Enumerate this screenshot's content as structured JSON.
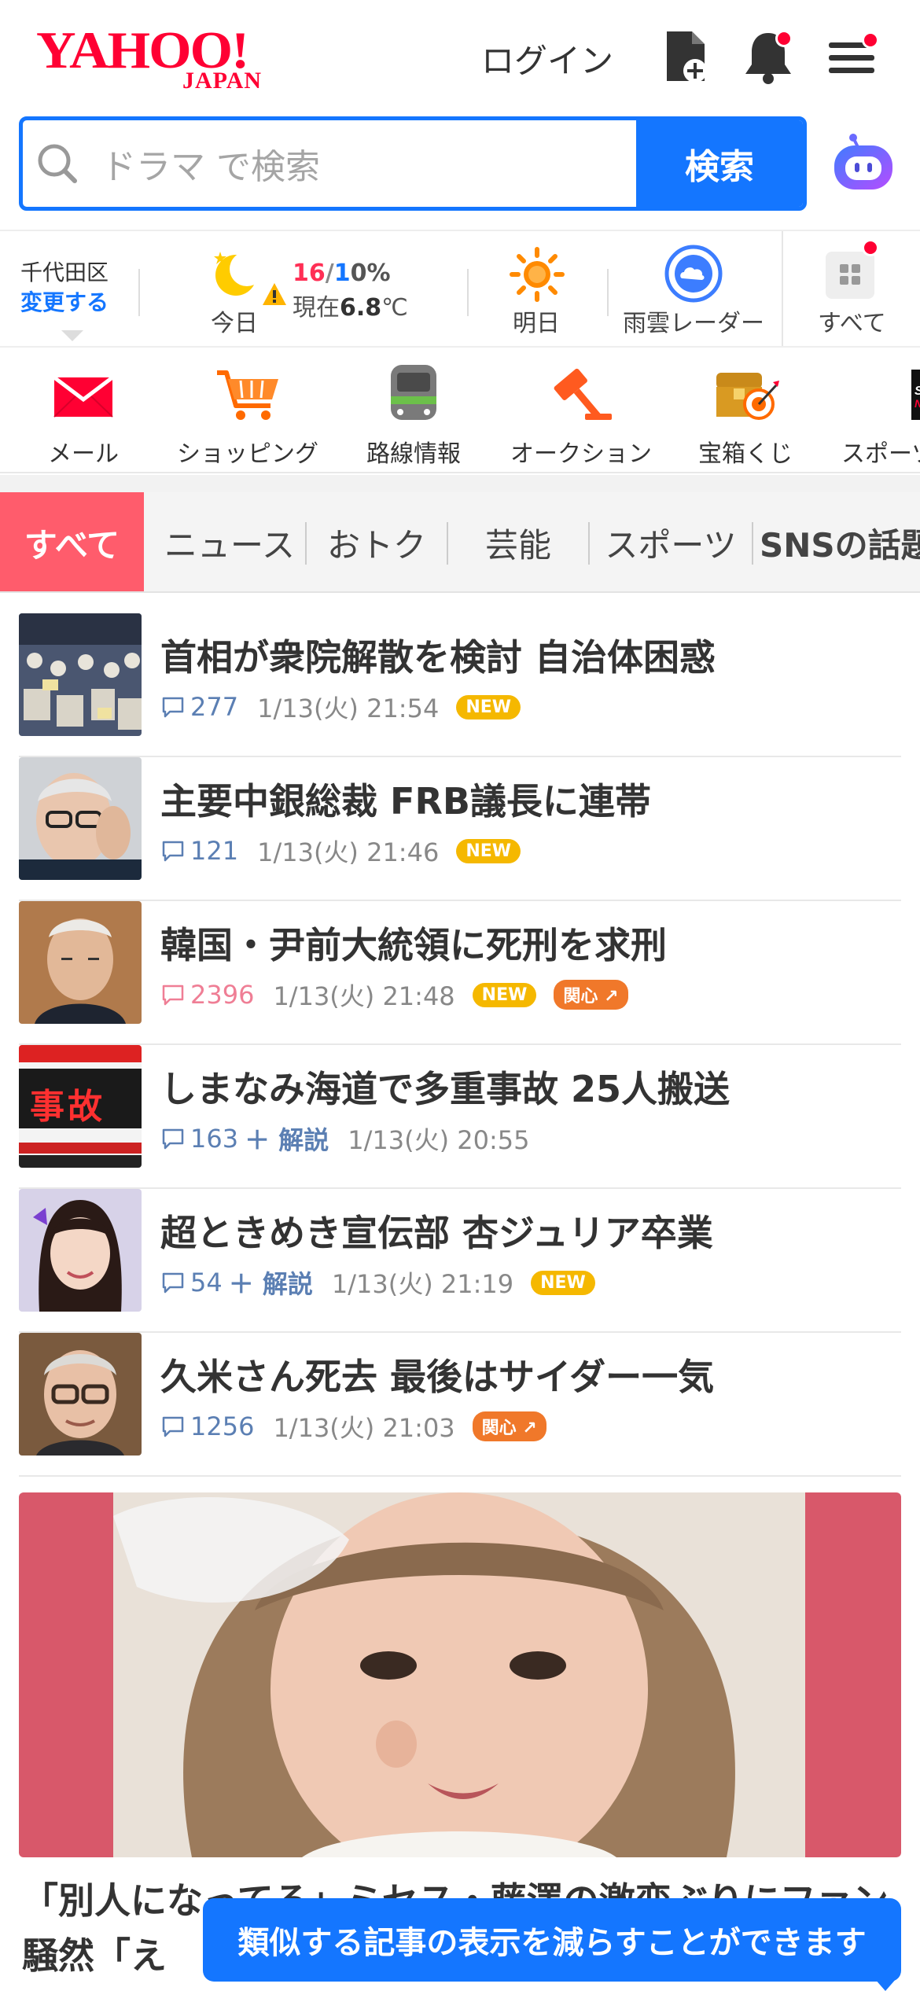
{
  "header": {
    "logo_main": "YAHOO!",
    "logo_sub": "JAPAN",
    "login_label": "ログイン"
  },
  "search": {
    "placeholder": "ドラマ で検索",
    "button_label": "検索"
  },
  "weather": {
    "location": "千代田区",
    "change_label": "変更する",
    "today_label": "今日",
    "high": "16",
    "low": "1",
    "precip": "0%",
    "now_prefix": "現在",
    "now_temp": "6.8",
    "now_unit": "℃",
    "tomorrow_label": "明日",
    "radar_label": "雨雲レーダー",
    "all_label": "すべて"
  },
  "services": [
    {
      "label": "メール"
    },
    {
      "label": "ショッピング"
    },
    {
      "label": "路線情報"
    },
    {
      "label": "オークション"
    },
    {
      "label": "宝箱くじ"
    },
    {
      "label": "スポーツ"
    }
  ],
  "tabs": [
    "すべて",
    "ニュース",
    "おトク",
    "芸能",
    "スポーツ",
    "SNSの話題"
  ],
  "articles": [
    {
      "title": "首相が衆院解散を検討 自治体困惑",
      "comments": "277",
      "date": "1/13(火) 21:54",
      "new_badge": "NEW"
    },
    {
      "title": "主要中銀総裁 FRB議長に連帯",
      "comments": "121",
      "date": "1/13(火) 21:46",
      "new_badge": "NEW"
    },
    {
      "title": "韓国・尹前大統領に死刑を求刑",
      "comments": "2396",
      "date": "1/13(火) 21:48",
      "new_badge": "NEW",
      "interest_badge": "関心"
    },
    {
      "title": "しまなみ海道で多重事故 25人搬送",
      "comments": "163",
      "extra": "＋ 解説",
      "date": "1/13(火) 20:55",
      "thumb_text": "事故"
    },
    {
      "title": "超ときめき宣伝部 杏ジュリア卒業",
      "comments": "54",
      "extra": "＋ 解説",
      "date": "1/13(火) 21:19",
      "new_badge": "NEW"
    },
    {
      "title": "久米さん死去 最後はサイダー一気",
      "comments": "1256",
      "date": "1/13(火) 21:03",
      "interest_badge": "関心"
    }
  ],
  "feature": {
    "title": "「別人になってる」ミセス・藤澤の激変ぶりにファン騒然「え"
  },
  "toast": {
    "label": "類似する記事の表示を減らすことができます"
  },
  "colors": {
    "brand_red": "#ff0033",
    "accent_blue": "#1476ff",
    "tab_active": "#ff5c6c",
    "new_badge": "#f5b800",
    "interest_badge": "#f0782a"
  }
}
